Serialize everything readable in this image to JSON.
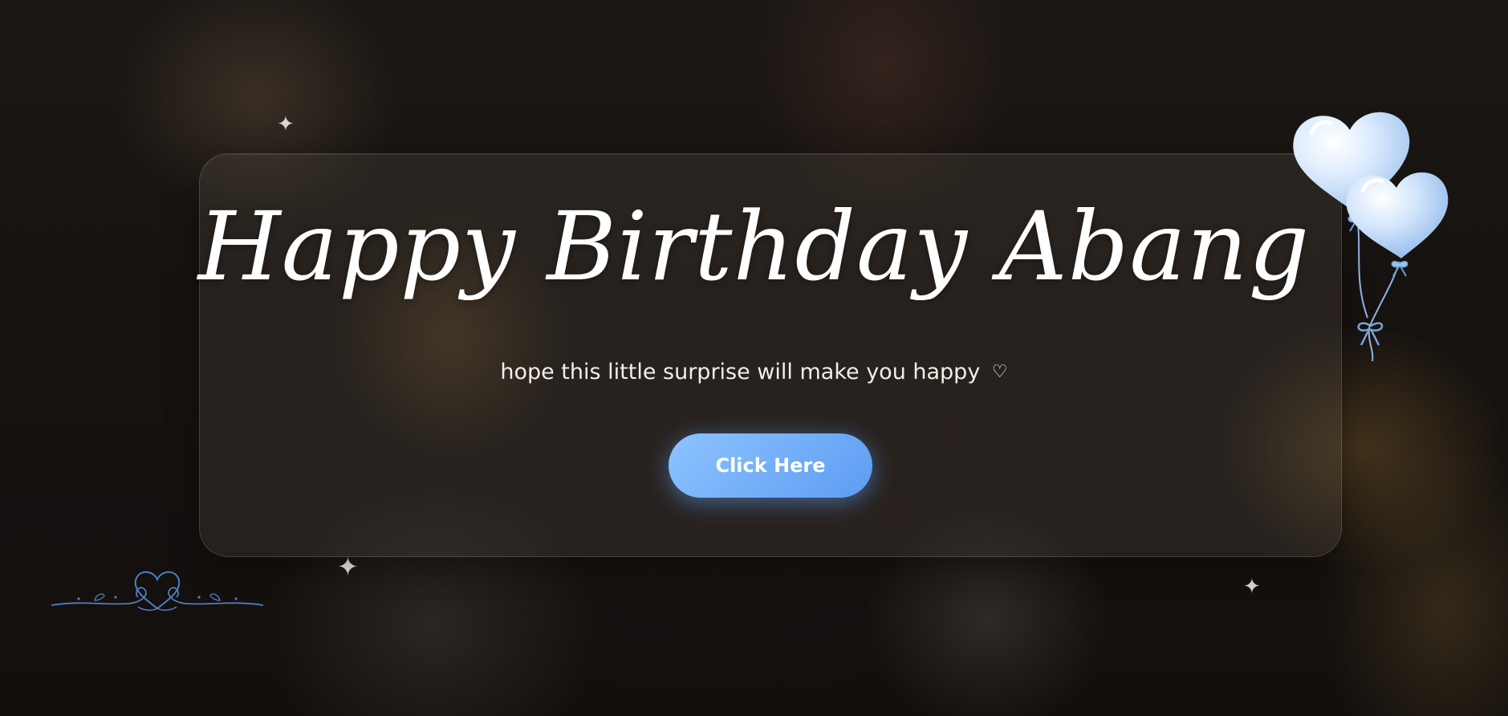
{
  "card": {
    "title": "Happy Birthday Abang",
    "subtitle": "hope this little surprise will make you happy",
    "subtitle_heart": "♡",
    "button_label": "Click Here"
  },
  "decorations": {
    "sparkle_glyph": "✦",
    "balloon_icon": "heart-balloons-icon",
    "divider_icon": "heart-swirl-divider-icon"
  },
  "colors": {
    "button_start": "#8ec3ff",
    "button_end": "#5d9cf2",
    "balloon": "#cfe3fb",
    "swirl": "#4f7fbf"
  }
}
